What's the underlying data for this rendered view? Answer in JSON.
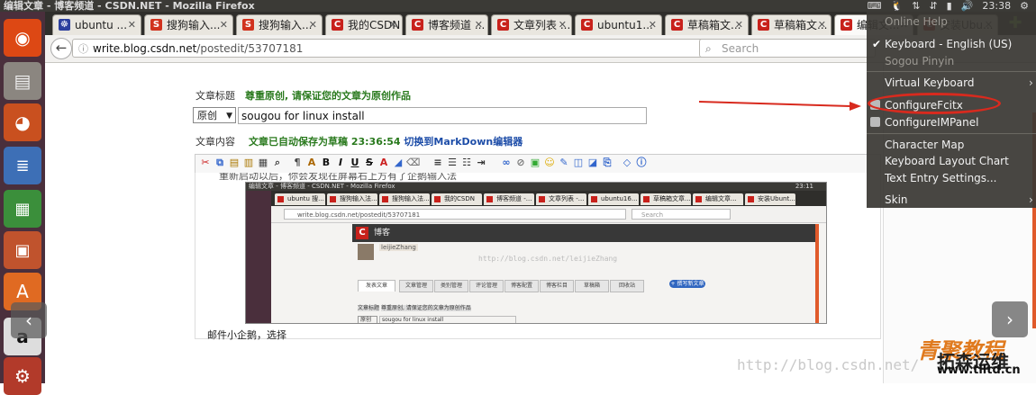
{
  "window": {
    "title": "编辑文章 - 博客频道 - CSDN.NET - Mozilla Firefox",
    "clock": "23:38"
  },
  "tabs": [
    {
      "label": "ubuntu ...",
      "favicon": "paw-icon",
      "color": "#2b3f9e"
    },
    {
      "label": "搜狗输入...",
      "favicon": "sogou-icon",
      "color": "#d1321e"
    },
    {
      "label": "搜狗输入...",
      "favicon": "sogou-icon",
      "color": "#d1321e"
    },
    {
      "label": "我的CSDN",
      "favicon": "csdn-icon",
      "color": "#c8211b"
    },
    {
      "label": "博客频道 ...",
      "favicon": "csdn-icon",
      "color": "#c8211b"
    },
    {
      "label": "文章列表 ...",
      "favicon": "csdn-icon",
      "color": "#c8211b"
    },
    {
      "label": "ubuntu1...",
      "favicon": "csdn-icon",
      "color": "#c8211b"
    },
    {
      "label": "草稿箱文...",
      "favicon": "csdn-icon",
      "color": "#c8211b"
    },
    {
      "label": "草稿箱文...",
      "favicon": "csdn-icon",
      "color": "#c8211b"
    },
    {
      "label": "编辑文...",
      "favicon": "csdn-icon",
      "color": "#c8211b",
      "active": true
    },
    {
      "label": "安装Ubu...",
      "favicon": "csdn-icon",
      "color": "#c8211b"
    }
  ],
  "address": {
    "host": "write.blog.csdn.net",
    "path": "/postedit/53707181"
  },
  "search": {
    "placeholder": "Search"
  },
  "form": {
    "title_label": "文章标题",
    "title_notice": "尊重原创, 请保证您的文章为原创作品",
    "type_value": "原创",
    "title_value": "sougou for linux install",
    "content_label": "文章内容",
    "autosave_notice": "文章已自动保存为草稿 23:36:54",
    "markdown_link": "切换到MarkDown编辑器"
  },
  "editor": {
    "cut_text": "重新启动以后，你会发现在屏幕右上方有了企鹅输入法",
    "body_text": "邮件小企鹅，选择"
  },
  "embedded": {
    "window_title": "编辑文章 - 博客频道 - CSDN.NET - Mozilla Firefox",
    "clock": "23:11",
    "tabs": [
      "ubuntu 搜...",
      "搜狗输入法...",
      "搜狗输入法...",
      "我的CSDN",
      "博客频道 -...",
      "文章列表 -...",
      "ubuntu16...",
      "草稿箱文章...",
      "编辑文章...",
      "安装Ubunt..."
    ],
    "url": "write.blog.csdn.net/postedit/53707181",
    "search": "Search",
    "blog_title": "博客",
    "user": "leijieZhang",
    "watermark": "http://blog.csdn.net/leijieZhang",
    "post_tabs": [
      "发表文章",
      "文章管理",
      "类别管理",
      "评论管理",
      "博客配置",
      "博客栏目",
      "草稿箱",
      "回收站"
    ],
    "new_button": "+ 撰写新文章",
    "row1_label": "文章标题",
    "row1_notice": "尊重原创, 请保证您的文章为原创作品",
    "row2_type": "原创",
    "row2_value": "sougou for linux install"
  },
  "menu": {
    "items": [
      {
        "label": "Online Help",
        "dim": true
      },
      {
        "label": "Keyboard - English (US)",
        "checked": true
      },
      {
        "label": "Sogou Pinyin",
        "dim": true
      },
      {
        "label": "Virtual Keyboard",
        "arrow": true
      },
      {
        "label": "ConfigureFcitx",
        "icon": true
      },
      {
        "label": "ConfigureIMPanel",
        "icon": true
      },
      {
        "label": "Character Map"
      },
      {
        "label": "Keyboard Layout Chart"
      },
      {
        "label": "Text Entry Settings..."
      },
      {
        "label": "Skin",
        "arrow": true
      }
    ]
  },
  "overlay": {
    "prev": "‹",
    "next": "›",
    "watermark": "http://blog.csdn.net/",
    "logo_cn": "青聚教程",
    "logo_cn2": "拓森运维",
    "logo_url": "www.tlltd.cn"
  }
}
